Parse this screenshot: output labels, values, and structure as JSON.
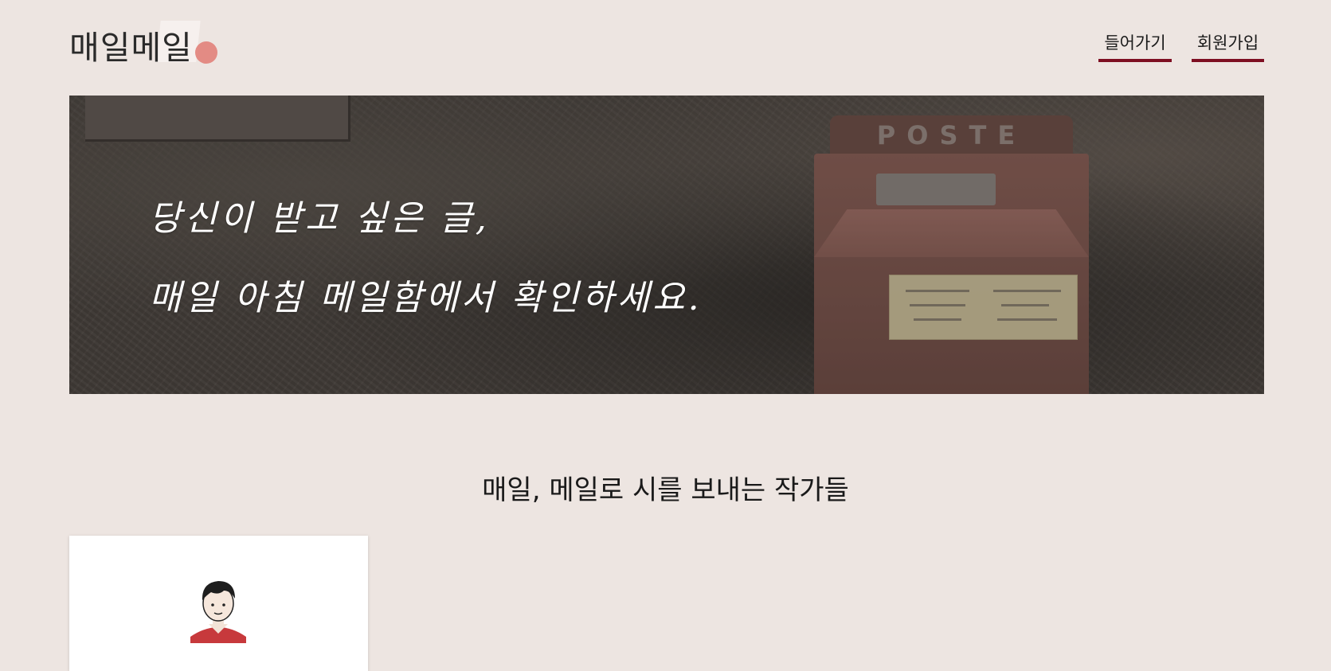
{
  "header": {
    "logo_text": "매일메일",
    "nav": {
      "login_label": "들어가기",
      "signup_label": "회원가입"
    }
  },
  "hero": {
    "line_1": "당신이 받고 싶은 글,",
    "line_2": "매일 아침 메일함에서 확인하세요.",
    "mailbox_brand": "POSTE"
  },
  "writers_section": {
    "title": "매일, 메일로 시를 보내는 작가들"
  },
  "colors": {
    "background": "#ede5e1",
    "accent": "#7e0f22",
    "logo_dot": "#e2837c"
  }
}
